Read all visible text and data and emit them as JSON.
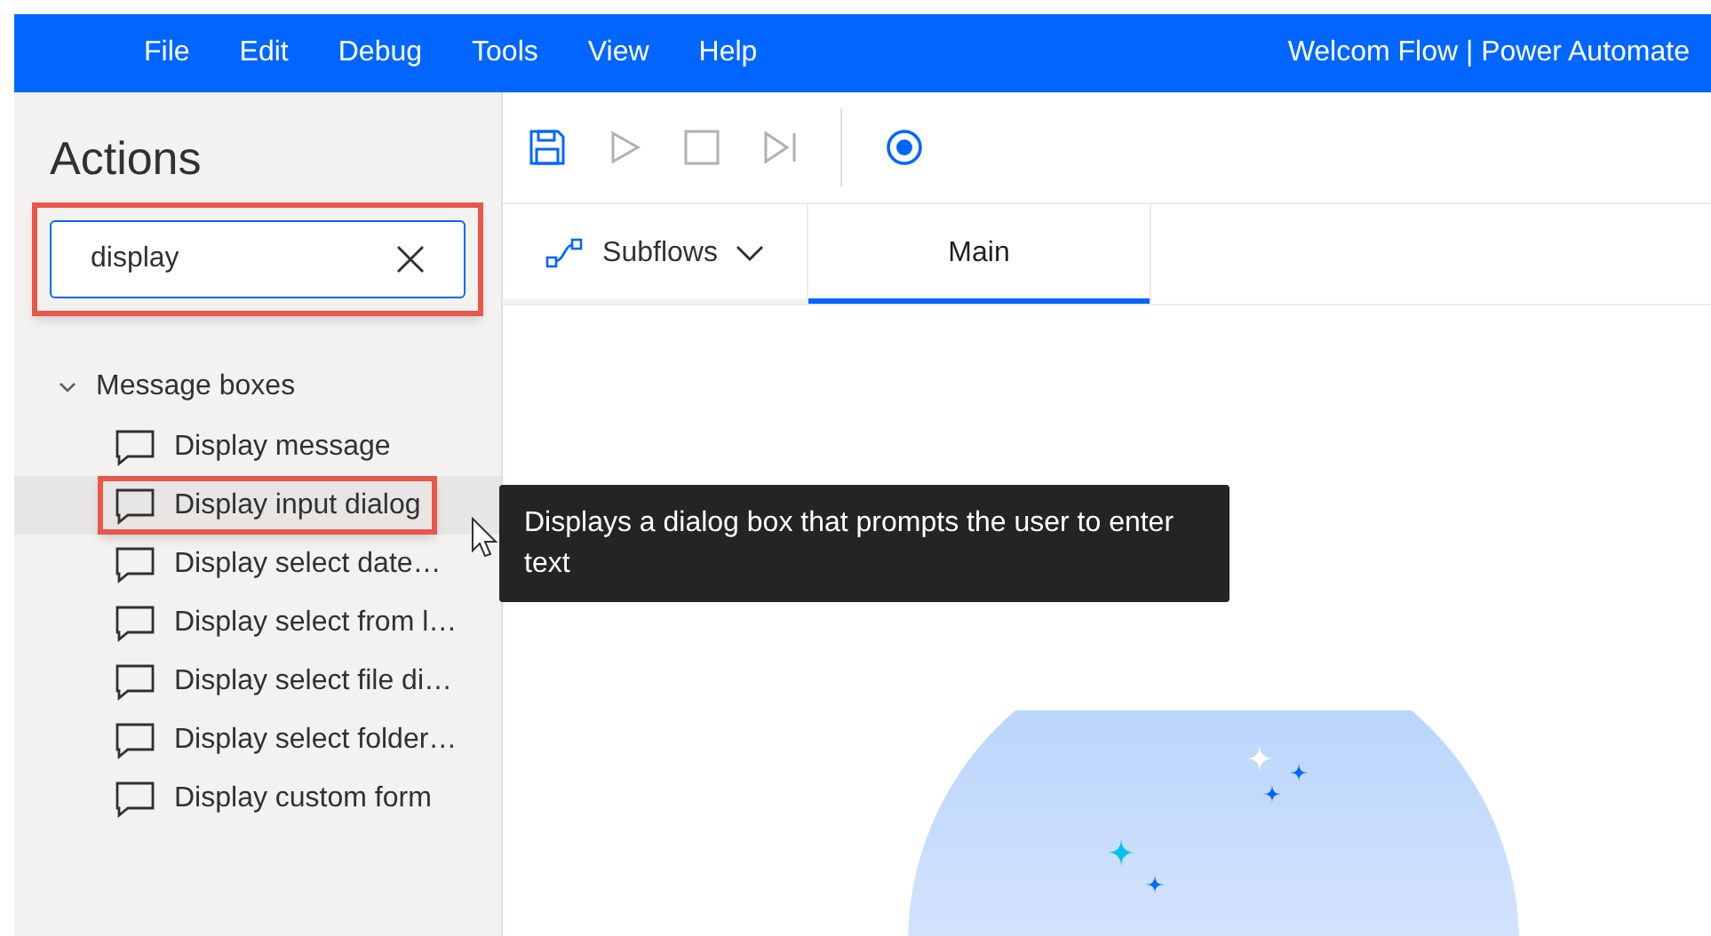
{
  "menu": [
    "File",
    "Edit",
    "Debug",
    "Tools",
    "View",
    "Help"
  ],
  "window": {
    "title": "Welcom Flow | Power Automate"
  },
  "sidebar": {
    "title": "Actions",
    "search": {
      "value": "display",
      "highlighted": true
    },
    "groups": [
      {
        "label": "Message boxes",
        "expanded": true,
        "children": [
          {
            "label": "Display message",
            "hovered": false,
            "highlighted": false
          },
          {
            "label": "Display input dialog",
            "hovered": true,
            "highlighted": true
          },
          {
            "label": "Display select date…",
            "hovered": false,
            "highlighted": false
          },
          {
            "label": "Display select from l…",
            "hovered": false,
            "highlighted": false
          },
          {
            "label": "Display select file di…",
            "hovered": false,
            "highlighted": false
          },
          {
            "label": "Display select folder…",
            "hovered": false,
            "highlighted": false
          },
          {
            "label": "Display custom form",
            "hovered": false,
            "highlighted": false
          }
        ]
      }
    ]
  },
  "toolbar": [
    {
      "kind": "save",
      "disabled": false
    },
    {
      "kind": "run",
      "disabled": true
    },
    {
      "kind": "stop",
      "disabled": true
    },
    {
      "kind": "step",
      "disabled": true
    },
    {
      "kind": "record",
      "disabled": false
    }
  ],
  "tabs": [
    {
      "label": "Subflows",
      "kind": "dropdown",
      "selected": false
    },
    {
      "label": "Main",
      "kind": "tab",
      "selected": true
    }
  ],
  "tooltip": {
    "text": "Displays a dialog box that prompts the user to enter text"
  }
}
